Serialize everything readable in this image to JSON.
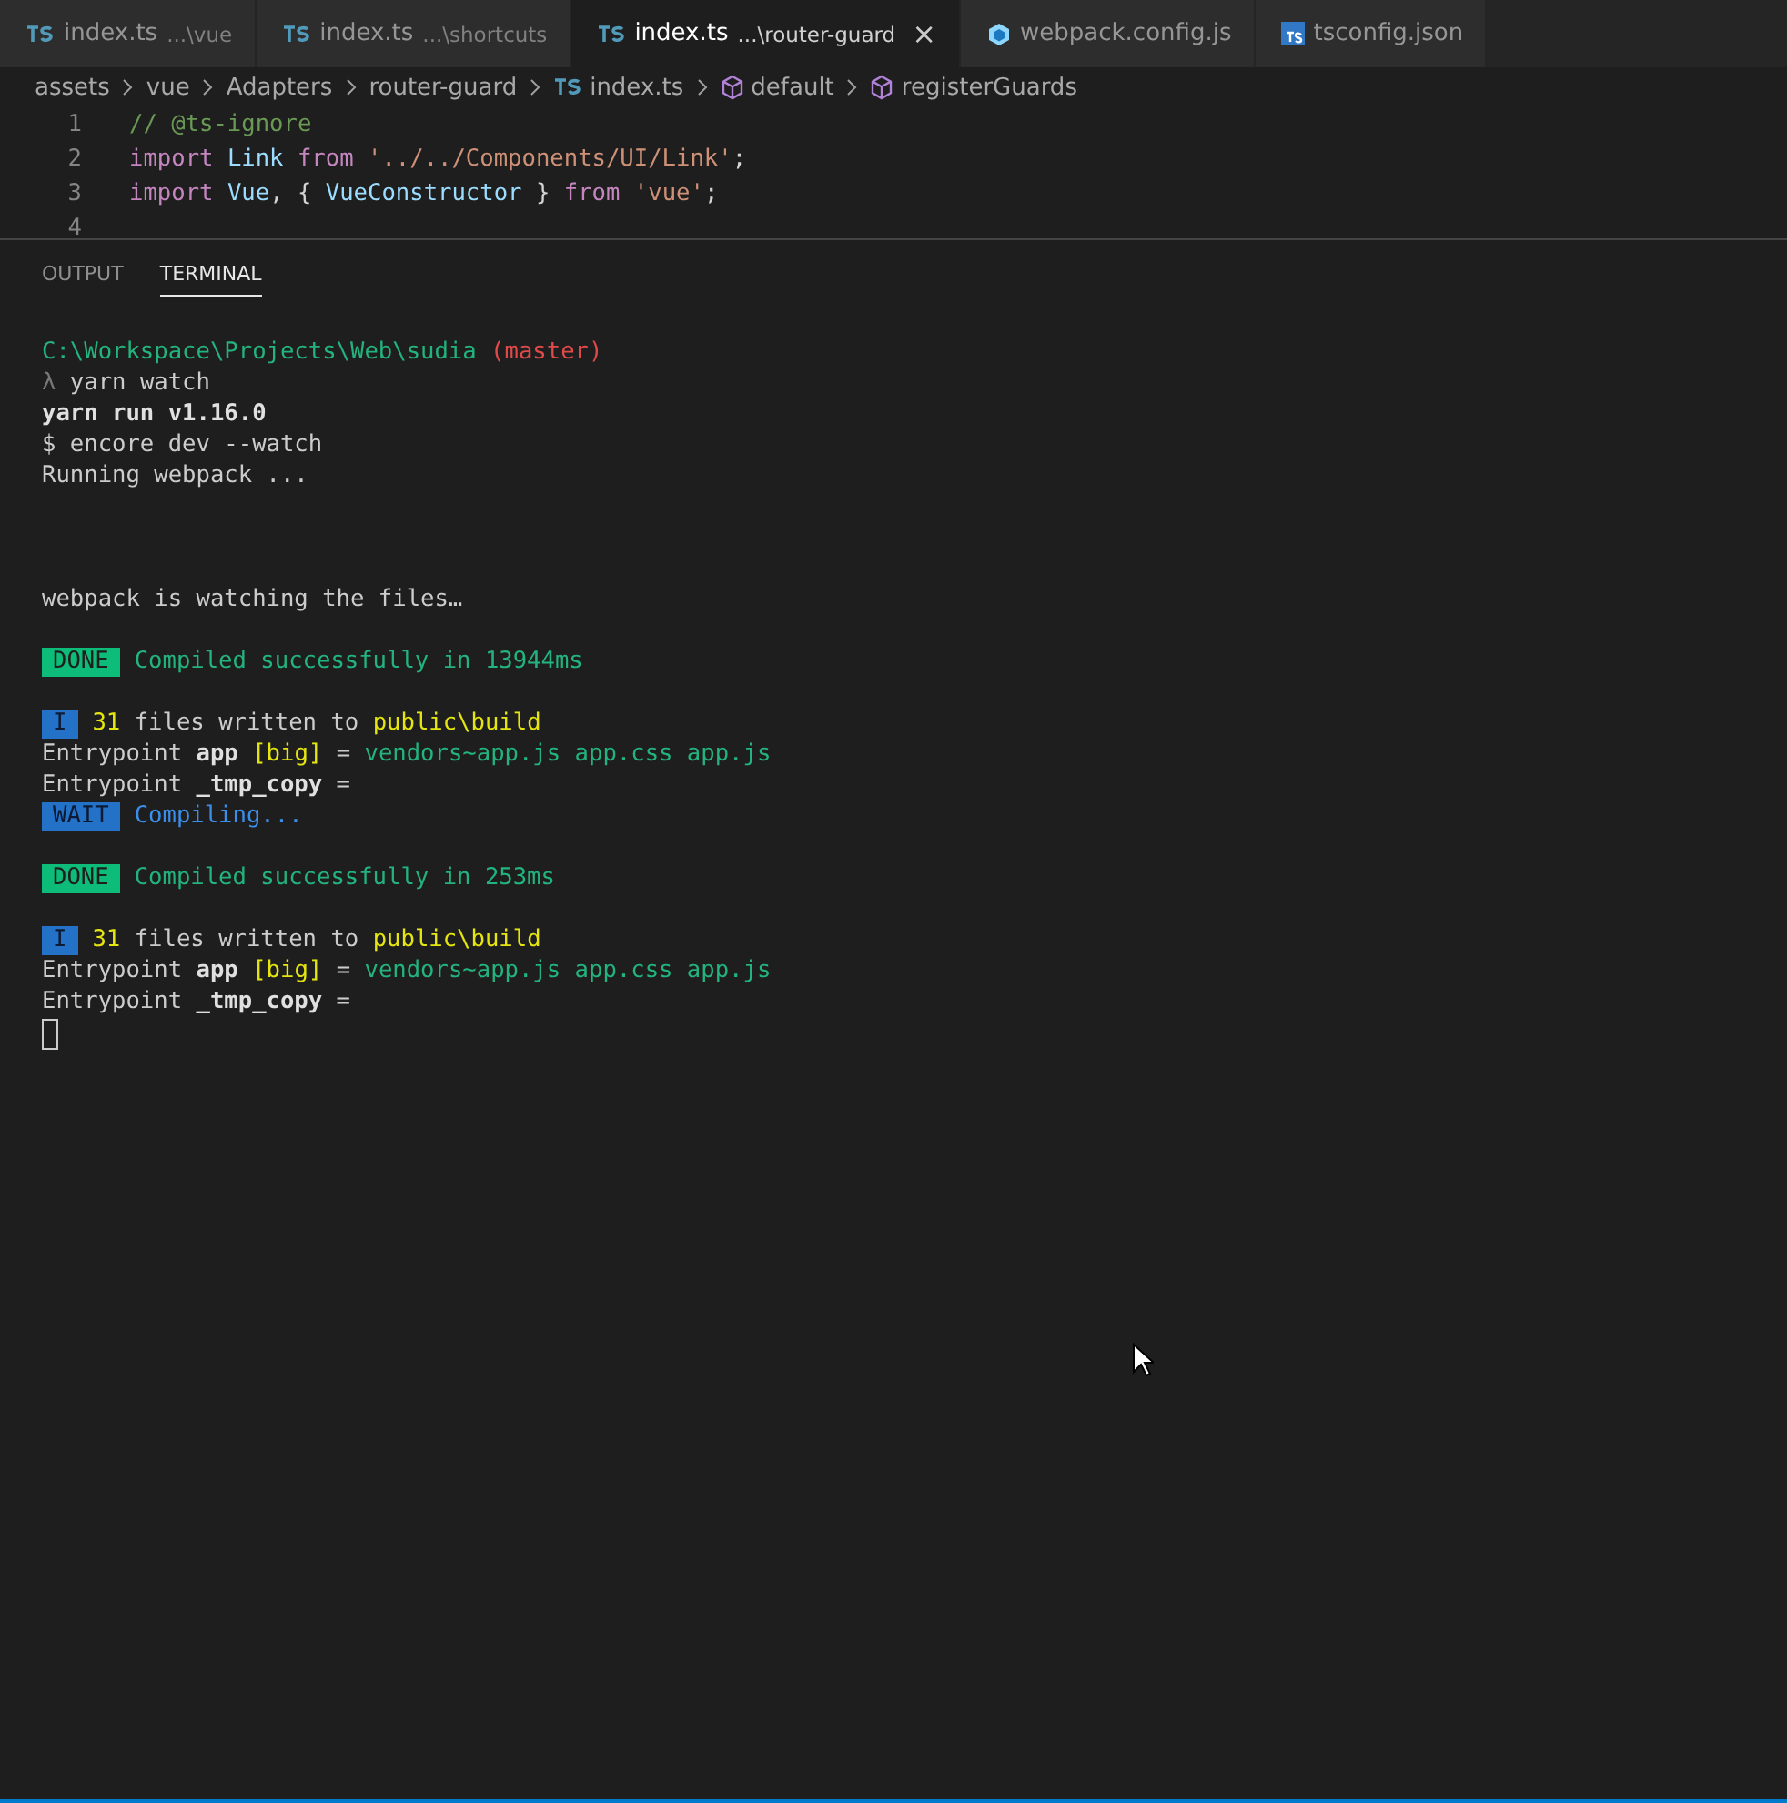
{
  "tabs": [
    {
      "kind": "ts",
      "name": "index.ts",
      "path": "...\\vue",
      "selected": false
    },
    {
      "kind": "ts",
      "name": "index.ts",
      "path": "...\\shortcuts",
      "selected": false
    },
    {
      "kind": "ts",
      "name": "index.ts",
      "path": "...\\router-guard",
      "selected": true,
      "close": "×"
    },
    {
      "kind": "webpack",
      "name": "webpack.config.js",
      "selected": false
    },
    {
      "kind": "tsconfig",
      "name": "tsconfig.json",
      "selected": false
    }
  ],
  "breadcrumbs": [
    {
      "kind": "folder",
      "label": "assets"
    },
    {
      "kind": "folder",
      "label": "vue"
    },
    {
      "kind": "folder",
      "label": "Adapters"
    },
    {
      "kind": "folder",
      "label": "router-guard"
    },
    {
      "kind": "ts",
      "label": "index.ts"
    },
    {
      "kind": "module",
      "label": "default"
    },
    {
      "kind": "module",
      "label": "registerGuards"
    }
  ],
  "code_lines": [
    {
      "number": "1",
      "tokens": [
        {
          "text": "// @ts-ignore",
          "kind": "comment"
        }
      ]
    },
    {
      "number": "2",
      "tokens": [
        {
          "text": "import",
          "kind": "keyword"
        },
        {
          "text": " Link",
          "kind": "ident"
        },
        {
          "text": " from",
          "kind": "keyword"
        },
        {
          "text": " '../../Components/UI/Link'",
          "kind": "string"
        },
        {
          "text": ";",
          "kind": "plain"
        }
      ]
    },
    {
      "number": "3",
      "tokens": [
        {
          "text": "import",
          "kind": "keyword"
        },
        {
          "text": " Vue",
          "kind": "ident"
        },
        {
          "text": ", { ",
          "kind": "plain"
        },
        {
          "text": "VueConstructor",
          "kind": "ident"
        },
        {
          "text": " } ",
          "kind": "plain"
        },
        {
          "text": "from",
          "kind": "keyword"
        },
        {
          "text": " 'vue'",
          "kind": "string"
        },
        {
          "text": ";",
          "kind": "plain"
        }
      ]
    },
    {
      "number": "4"
    }
  ],
  "panel_tabs": [
    {
      "label": "OUTPUT",
      "selected": false
    },
    {
      "label": "TERMINAL",
      "selected": true
    }
  ],
  "terminal_blocks": [
    {
      "wide_gap": false,
      "lines": [
        {
          "segments": [
            {
              "text": "C:\\Workspace\\Projects\\Web\\sudia",
              "kind": "green"
            },
            {
              "text": " (master)",
              "kind": "red"
            }
          ]
        },
        {
          "segments": [
            {
              "text": "λ",
              "kind": "dim"
            },
            {
              "text": " yarn watch",
              "kind": "plain"
            }
          ]
        },
        {
          "segments": [
            {
              "text": "yarn run v1.16.0",
              "kind": "bold"
            }
          ]
        },
        {
          "segments": [
            {
              "text": "$ encore dev --watch",
              "kind": "plain"
            }
          ]
        },
        {
          "segments": [
            {
              "text": "Running webpack ...",
              "kind": "plain"
            }
          ]
        }
      ]
    },
    {
      "wide_gap": true,
      "lines": [
        {
          "segments": [
            {
              "text": "webpack is watching the files…",
              "kind": "plain"
            }
          ]
        }
      ]
    },
    {
      "wide_gap": false,
      "lines": [
        {
          "badge": {
            "text": "DONE",
            "kind": "success"
          },
          "segments": [
            {
              "text": "Compiled successfully in 13944ms",
              "kind": "green"
            }
          ]
        }
      ]
    },
    {
      "wide_gap": false,
      "lines": [
        {
          "badge": {
            "text": "I",
            "kind": "info"
          },
          "segments": [
            {
              "text": "31",
              "kind": "yellow"
            },
            {
              "text": " files written to ",
              "kind": "plain"
            },
            {
              "text": "public\\build",
              "kind": "yellow"
            }
          ]
        },
        {
          "segments": [
            {
              "text": "Entrypoint ",
              "kind": "plain"
            },
            {
              "text": "app",
              "kind": "bold"
            },
            {
              "text": " [big]",
              "kind": "yellow"
            },
            {
              "text": " = ",
              "kind": "plain"
            },
            {
              "text": "vendors~app.js app.css app.js",
              "kind": "green"
            }
          ]
        },
        {
          "segments": [
            {
              "text": "Entrypoint ",
              "kind": "plain"
            },
            {
              "text": "_tmp_copy",
              "kind": "bold"
            },
            {
              "text": " =",
              "kind": "plain"
            }
          ]
        },
        {
          "badge": {
            "text": "WAIT",
            "kind": "info"
          },
          "segments": [
            {
              "text": "Compiling...",
              "kind": "blue"
            }
          ]
        }
      ]
    },
    {
      "wide_gap": false,
      "lines": [
        {
          "badge": {
            "text": "DONE",
            "kind": "success"
          },
          "segments": [
            {
              "text": "Compiled successfully in 253ms",
              "kind": "green"
            }
          ]
        }
      ]
    },
    {
      "wide_gap": false,
      "lines": [
        {
          "badge": {
            "text": "I",
            "kind": "info"
          },
          "segments": [
            {
              "text": "31",
              "kind": "yellow"
            },
            {
              "text": " files written to ",
              "kind": "plain"
            },
            {
              "text": "public\\build",
              "kind": "yellow"
            }
          ]
        },
        {
          "segments": [
            {
              "text": "Entrypoint ",
              "kind": "plain"
            },
            {
              "text": "app",
              "kind": "bold"
            },
            {
              "text": " [big]",
              "kind": "yellow"
            },
            {
              "text": " = ",
              "kind": "plain"
            },
            {
              "text": "vendors~app.js app.css app.js",
              "kind": "green"
            }
          ]
        },
        {
          "segments": [
            {
              "text": "Entrypoint ",
              "kind": "plain"
            },
            {
              "text": "_tmp_copy",
              "kind": "bold"
            },
            {
              "text": " =",
              "kind": "plain"
            }
          ]
        }
      ]
    }
  ]
}
